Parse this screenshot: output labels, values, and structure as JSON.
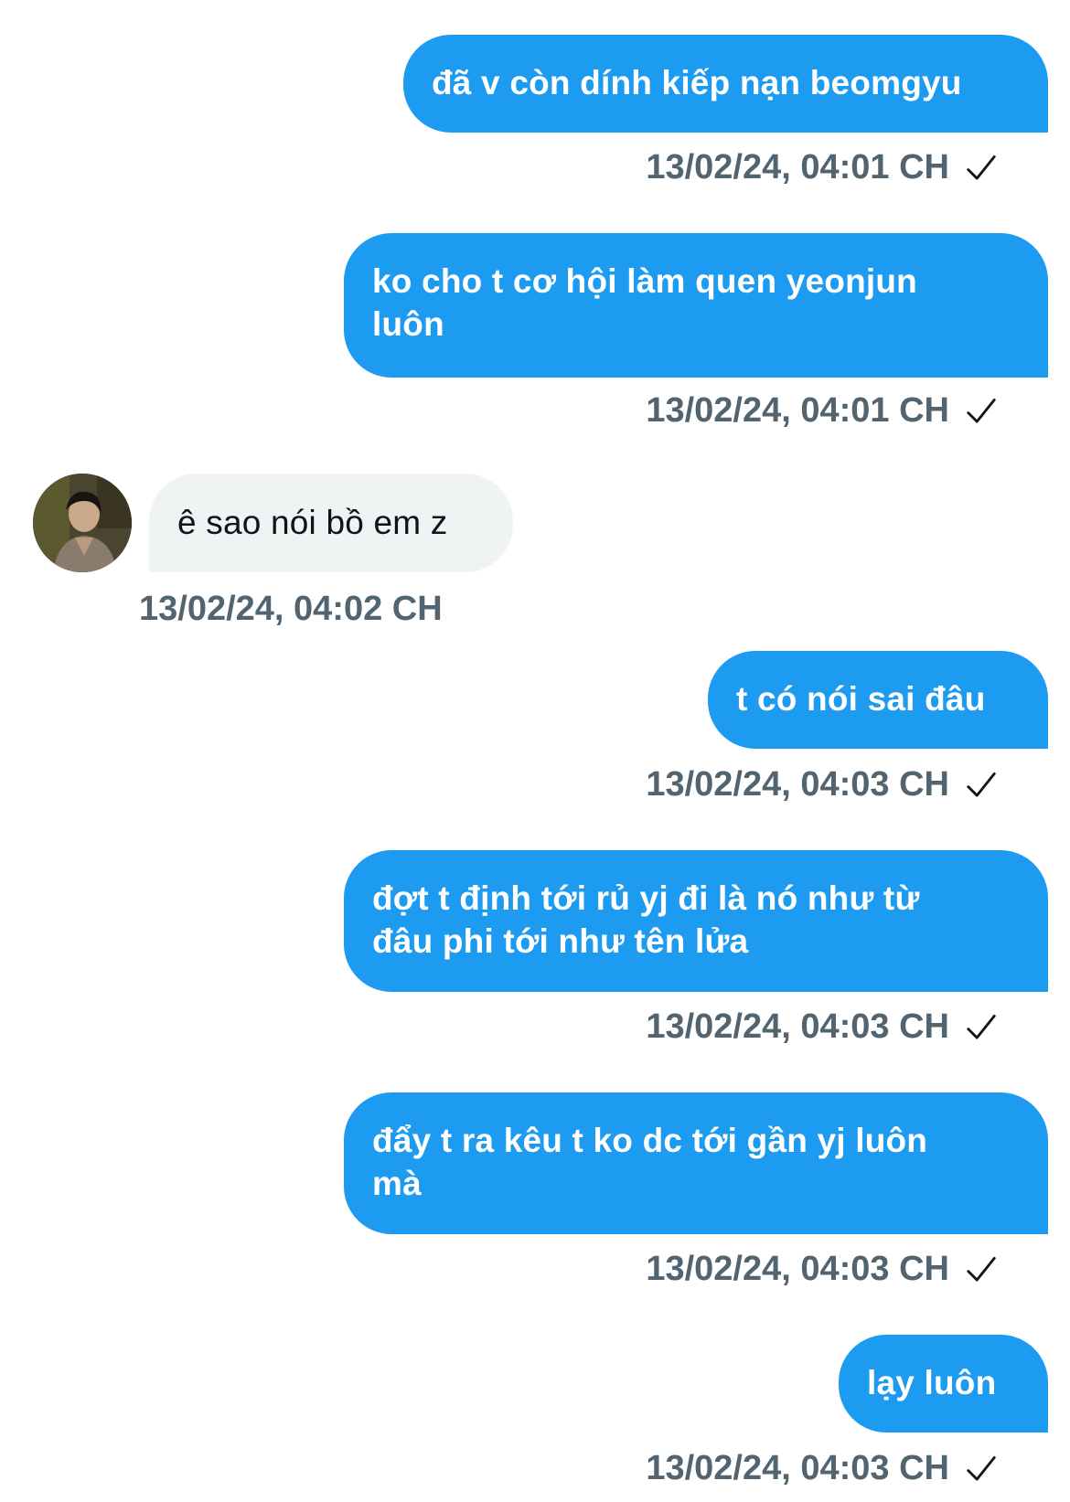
{
  "colors": {
    "outgoing_bubble": "#1d9bf0",
    "incoming_bubble": "#eff3f4",
    "timestamp": "#536471"
  },
  "messages": [
    {
      "direction": "outgoing",
      "text": "đã v còn dính kiếp nạn beomgyu",
      "time": "13/02/24, 04:01 CH",
      "status_icon": "check-icon"
    },
    {
      "direction": "outgoing",
      "text": "ko cho t cơ hội làm quen yeonjun\nluôn",
      "time": "13/02/24, 04:01 CH",
      "status_icon": "check-icon"
    },
    {
      "direction": "incoming",
      "text": "ê sao nói bồ em z",
      "time": "13/02/24, 04:02 CH",
      "avatar_icon": "user-avatar"
    },
    {
      "direction": "outgoing",
      "text": "t có nói sai đâu",
      "time": "13/02/24, 04:03 CH",
      "status_icon": "check-icon"
    },
    {
      "direction": "outgoing",
      "text": "đợt t định tới rủ yj đi là nó như từ\nđâu phi tới như tên lửa",
      "time": "13/02/24, 04:03 CH",
      "status_icon": "check-icon"
    },
    {
      "direction": "outgoing",
      "text": "đẩy t ra kêu t ko dc tới gần yj luôn\nmà",
      "time": "13/02/24, 04:03 CH",
      "status_icon": "check-icon"
    },
    {
      "direction": "outgoing",
      "text": "lạy luôn",
      "time": "13/02/24, 04:03 CH",
      "status_icon": "check-icon"
    }
  ]
}
